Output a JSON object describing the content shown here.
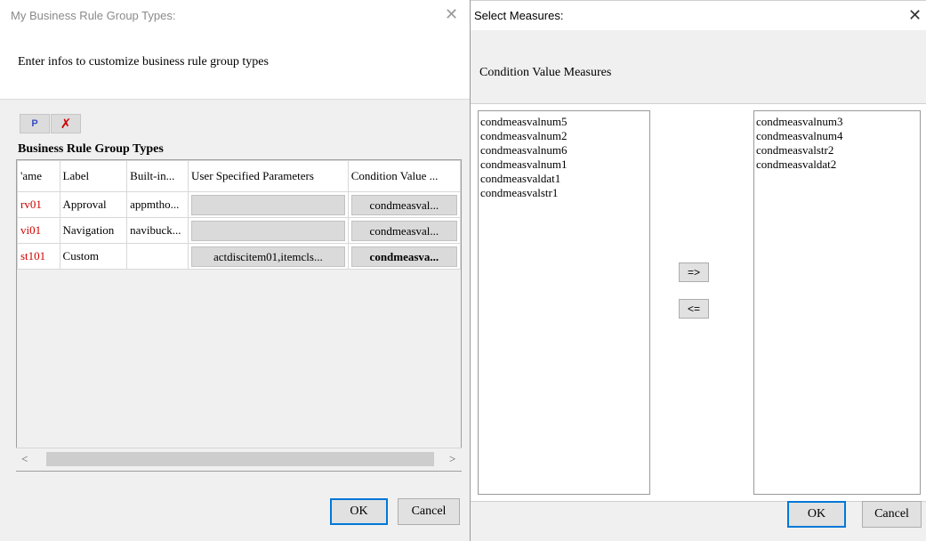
{
  "business_rule_dialog": {
    "title": "My Business Rule Group Types:",
    "subtitle": "Enter infos to customize business rule group types",
    "section_title": "Business Rule Group Types",
    "toolbar": {
      "add_glyph": "P",
      "delete_glyph": "✗"
    },
    "columns": [
      "'ame",
      "Label",
      "Built-in...",
      "User Specified Parameters",
      "Condition Value ..."
    ],
    "rows": [
      {
        "name": "rv01",
        "label": "Approval",
        "builtin": "appmtho...",
        "params": "",
        "condition": "condmeasval..."
      },
      {
        "name": "vi01",
        "label": "Navigation",
        "builtin": "navibuck...",
        "params": "",
        "condition": "condmeasval..."
      },
      {
        "name": "st101",
        "label": "Custom",
        "builtin": "",
        "params": "actdiscitem01,itemcls...",
        "condition": "condmeasva..."
      }
    ],
    "scroll_left": "<",
    "scroll_right": ">",
    "ok_label": "OK",
    "cancel_label": "Cancel"
  },
  "select_measures_dialog": {
    "title": "Select Measures:",
    "subtitle": "Condition Value Measures",
    "available": [
      "condmeasvalnum5",
      "condmeasvalnum2",
      "condmeasvalnum6",
      "condmeasvalnum1",
      "condmeasvaldat1",
      "condmeasvalstr1"
    ],
    "selected": [
      "condmeasvalnum3",
      "condmeasvalnum4",
      "condmeasvalstr2",
      "condmeasvaldat2"
    ],
    "move_right_label": "=>",
    "move_left_label": "<=",
    "ok_label": "OK",
    "cancel_label": "Cancel"
  },
  "icons": {
    "close": "close-icon",
    "add": "add-icon",
    "delete": "delete-icon"
  },
  "colors": {
    "name_text": "#d00000",
    "focus_border": "#0078d7"
  }
}
